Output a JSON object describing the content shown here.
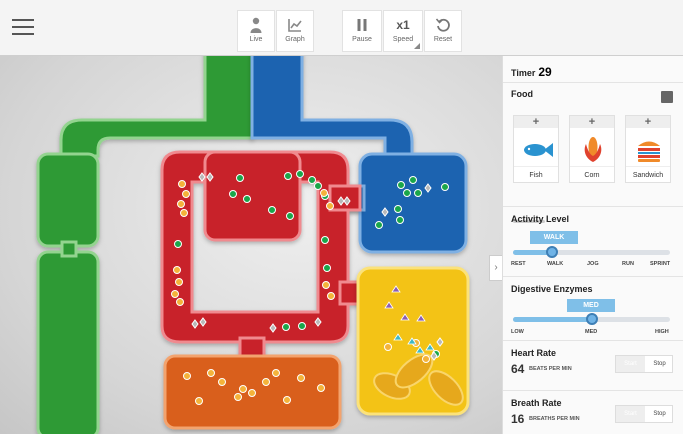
{
  "toolbar": {
    "live_label": "Live",
    "graph_label": "Graph",
    "pause_label": "Pause",
    "speed_value": "x1",
    "speed_label": "Speed",
    "reset_label": "Reset"
  },
  "panel": {
    "timer_label": "Timer",
    "timer_value": "29",
    "food_title": "Food",
    "foods": [
      {
        "label": "Fish",
        "add": "+"
      },
      {
        "label": "Corn",
        "add": "+"
      },
      {
        "label": "Sandwich",
        "add": "+"
      }
    ],
    "activity": {
      "title": "Activity Level",
      "current": "WALK",
      "value_fraction": 0.25,
      "ticks": [
        "REST",
        "WALK",
        "JOG",
        "RUN",
        "SPRINT"
      ]
    },
    "enzymes": {
      "title": "Digestive Enzymes",
      "current": "MED",
      "value_fraction": 0.5,
      "ticks": [
        "LOW",
        "MED",
        "HIGH"
      ]
    },
    "heart_rate": {
      "title": "Heart Rate",
      "value": "64",
      "unit": "BEATS PER MIN",
      "start": "Start",
      "stop": "Stop"
    },
    "breath_rate": {
      "title": "Breath Rate",
      "value": "16",
      "unit": "BREATHS PER MIN",
      "start": "Start",
      "stop": "Stop"
    }
  },
  "colors": {
    "blood": "#c8232c",
    "lungs": "#1b64b0",
    "body": "#2f9a35",
    "digestive": "#d95f1a",
    "muscle": "#f3c318",
    "accent": "#7fbfe8"
  }
}
